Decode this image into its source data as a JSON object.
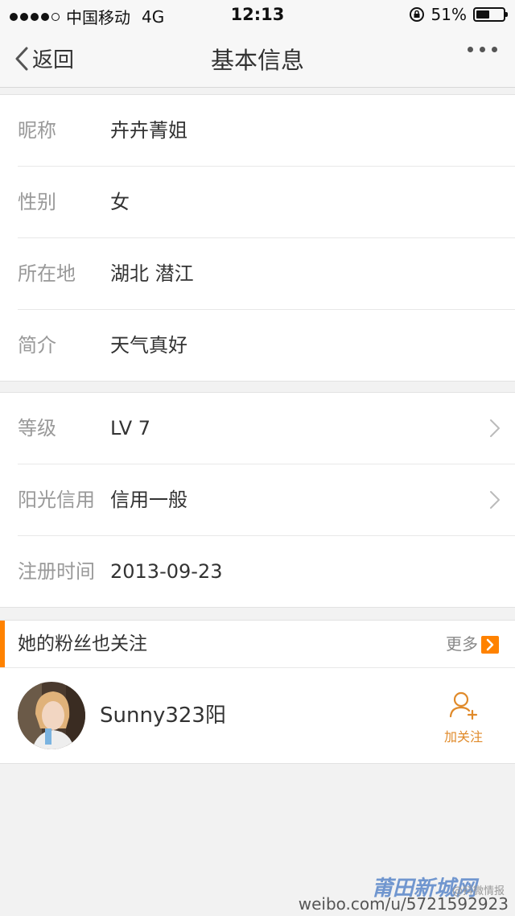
{
  "statusbar": {
    "carrier": "中国移动",
    "network": "4G",
    "time": "12:13",
    "battery_text": "51%",
    "battery_level": 0.51
  },
  "navbar": {
    "back_label": "返回",
    "title": "基本信息"
  },
  "profile": {
    "items": [
      {
        "label": "昵称",
        "value": "卉卉菁姐"
      },
      {
        "label": "性别",
        "value": "女"
      },
      {
        "label": "所在地",
        "value": "湖北 潜江"
      },
      {
        "label": "简介",
        "value": "天气真好"
      }
    ]
  },
  "account": {
    "items": [
      {
        "label": "等级",
        "value": "LV 7"
      },
      {
        "label": "阳光信用",
        "value": "信用一般"
      },
      {
        "label": "注册时间",
        "value": "2013-09-23"
      }
    ]
  },
  "fans": {
    "title": "她的粉丝也关注",
    "more_label": "更多",
    "user": {
      "name": "Sunny323阳",
      "follow_label": "加关注"
    }
  },
  "watermark": {
    "logo": "莆田新城网",
    "handle": "@抖微情报",
    "url": "weibo.com/u/5721592923"
  },
  "colors": {
    "accent": "#ff8200",
    "follow": "#e08a2a"
  }
}
